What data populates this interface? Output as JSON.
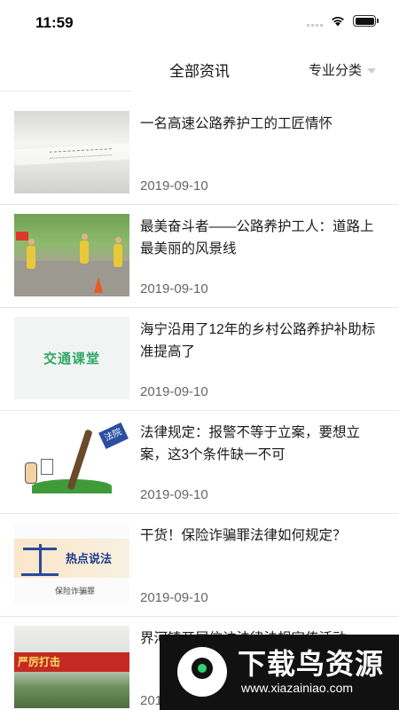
{
  "status_bar": {
    "time": "11:59"
  },
  "nav": {
    "title": "全部资讯",
    "filter_label": "专业分类"
  },
  "articles": [
    {
      "title": "一名高速公路养护工的工匠情怀",
      "date": "2019-09-10",
      "thumb": "paper-document-photo"
    },
    {
      "title": "最美奋斗者——公路养护工人：道路上最美丽的风景线",
      "date": "2019-09-10",
      "thumb": "road-workers-photo"
    },
    {
      "title": "海宁沿用了12年的乡村公路养护补助标准提高了",
      "date": "2019-09-10",
      "thumb": "jiaotong-ketang-logo",
      "thumb_text": "交通课堂"
    },
    {
      "title": "法律规定：报警不等于立案，要想立案，这3个条件缺一不可",
      "date": "2019-09-10",
      "thumb": "law-cartoon",
      "thumb_text": "法院"
    },
    {
      "title": "干货！保险诈骗罪法律如何规定？",
      "date": "2019-09-10",
      "thumb": "hot-topic-law-banner",
      "thumb_text": "热点说法",
      "thumb_sub": "保险诈骗罪"
    },
    {
      "title": "界河镇开展信访法律法规宣传活动",
      "date": "2019-09-10",
      "thumb": "red-banner-photo",
      "thumb_text": "严厉打击"
    }
  ],
  "watermark": {
    "title": "下载鸟资源",
    "url": "www.xiazainiao.com"
  },
  "colors": {
    "background": "#ffffff",
    "divider": "#e6e6e6",
    "date_text": "#666666",
    "logo_green": "#2fa865"
  }
}
